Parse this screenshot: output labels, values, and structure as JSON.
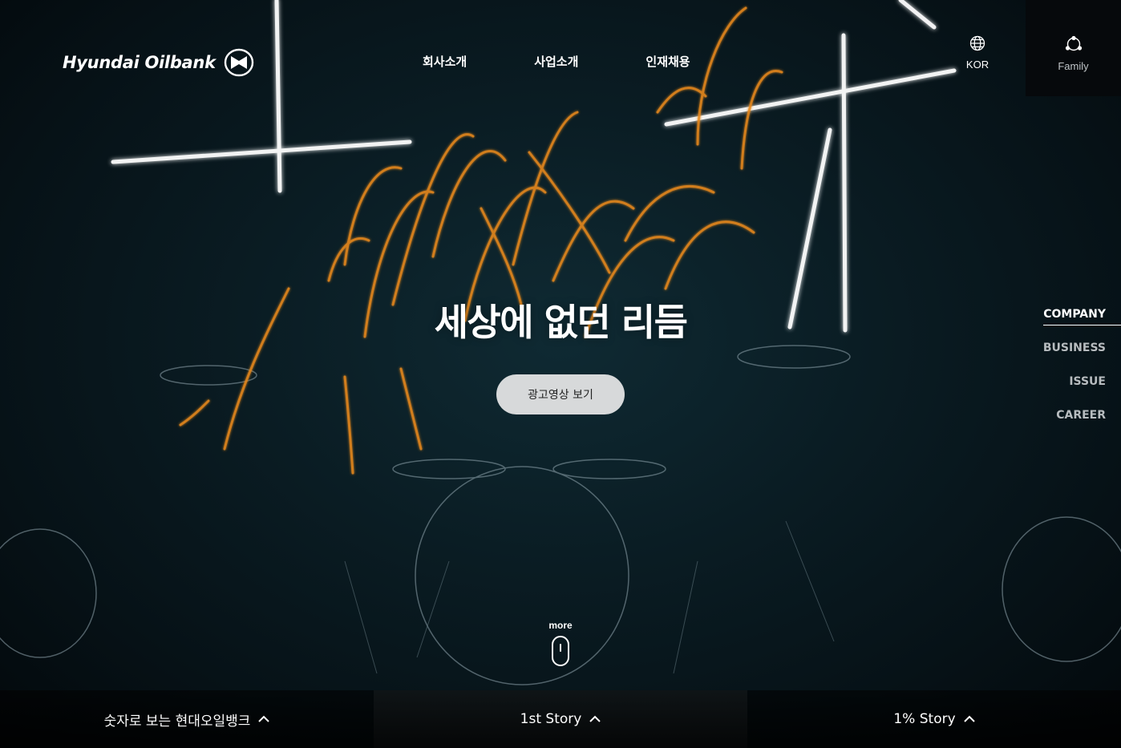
{
  "brand": {
    "name": "Hyundai Oilbank",
    "logo_icon": "hyundai-oilbank-emblem-icon"
  },
  "gnb": {
    "items": [
      {
        "label": "회사소개"
      },
      {
        "label": "사업소개"
      },
      {
        "label": "인재채용"
      }
    ]
  },
  "utility": {
    "language": {
      "label": "KOR",
      "icon": "globe-icon"
    },
    "family": {
      "label": "Family",
      "icon": "family-network-icon"
    }
  },
  "hero": {
    "headline_regular": "세상에 없던 ",
    "headline_bold": "리듬",
    "cta_label": "광고영상 보기"
  },
  "side_nav": {
    "items": [
      {
        "label": "COMPANY",
        "active": true
      },
      {
        "label": "BUSINESS",
        "active": false
      },
      {
        "label": "ISSUE",
        "active": false
      },
      {
        "label": "CAREER",
        "active": false
      }
    ]
  },
  "scroll": {
    "label": "more",
    "icon": "mouse-scroll-icon"
  },
  "bottom_bar": {
    "tabs": [
      {
        "label": "숫자로 보는 현대오일뱅크"
      },
      {
        "label": "1st Story"
      },
      {
        "label": "1% Story"
      }
    ]
  },
  "colors": {
    "cta_bg": "#d7d9da",
    "background": "#0a1c23",
    "spark": "#e8891e",
    "neon": "#ffffff"
  }
}
